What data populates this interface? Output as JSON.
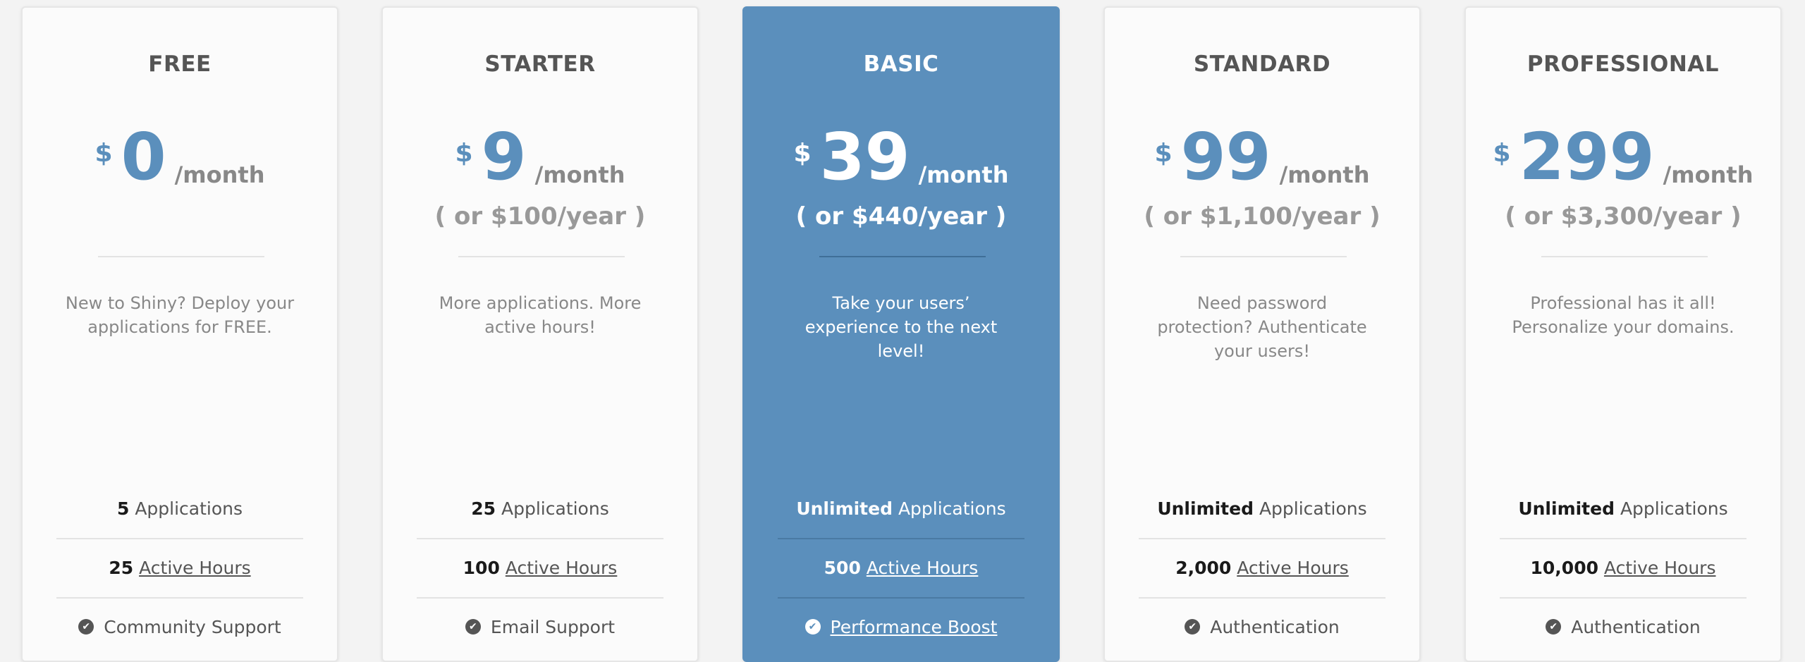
{
  "plans": [
    {
      "name": "FREE",
      "currency": "$",
      "amount": "0",
      "period": "/month",
      "yearly": "",
      "description": "New to Shiny? Deploy your applications for FREE.",
      "apps_count": "5",
      "apps_label": "Applications",
      "hours_count": "25",
      "hours_label": "Active Hours",
      "extra_feature": "Community Support"
    },
    {
      "name": "STARTER",
      "currency": "$",
      "amount": "9",
      "period": "/month",
      "yearly": "( or $100/year )",
      "description": "More applications. More active hours!",
      "apps_count": "25",
      "apps_label": "Applications",
      "hours_count": "100",
      "hours_label": "Active Hours",
      "extra_feature": "Email Support"
    },
    {
      "name": "BASIC",
      "currency": "$",
      "amount": "39",
      "period": "/month",
      "yearly": "( or $440/year )",
      "description": "Take your users’ experience to the next level!",
      "apps_count": "Unlimited",
      "apps_label": "Applications",
      "hours_count": "500",
      "hours_label": "Active Hours",
      "extra_feature": "Performance Boost"
    },
    {
      "name": "STANDARD",
      "currency": "$",
      "amount": "99",
      "period": "/month",
      "yearly": "( or $1,100/year )",
      "description": "Need password protection? Authenticate your users!",
      "apps_count": "Unlimited",
      "apps_label": "Applications",
      "hours_count": "2,000",
      "hours_label": "Active Hours",
      "extra_feature": "Authentication"
    },
    {
      "name": "PROFESSIONAL",
      "currency": "$",
      "amount": "299",
      "period": "/month",
      "yearly": "( or $3,300/year )",
      "description": "Professional has it all! Personalize your domains.",
      "apps_count": "Unlimited",
      "apps_label": "Applications",
      "hours_count": "10,000",
      "hours_label": "Active Hours",
      "extra_feature": "Authentication"
    }
  ],
  "colors": {
    "accent": "#5b8fbc",
    "card_background": "#fbfbfb",
    "page_background": "#f3f3f3"
  },
  "icons": {
    "feature_check": "check-circle-icon"
  }
}
